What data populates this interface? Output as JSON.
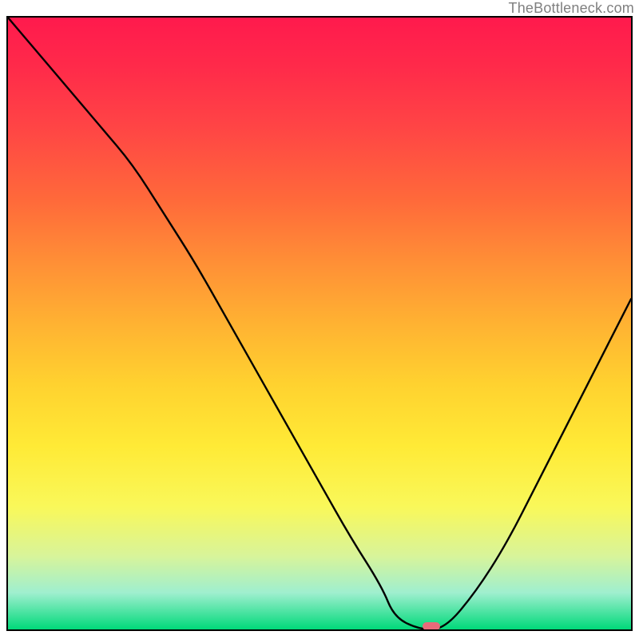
{
  "watermark": "TheBottleneck.com",
  "chart_data": {
    "type": "line",
    "title": "",
    "xlabel": "",
    "ylabel": "",
    "xlim": [
      0,
      100
    ],
    "ylim": [
      0,
      100
    ],
    "x": [
      0,
      5,
      10,
      15,
      20,
      25,
      30,
      35,
      40,
      45,
      50,
      55,
      60,
      62,
      66,
      70,
      75,
      80,
      85,
      90,
      95,
      100
    ],
    "values": [
      100,
      94,
      88,
      82,
      76,
      68,
      60,
      51,
      42,
      33,
      24,
      15,
      7,
      2,
      0,
      0,
      6,
      14,
      24,
      34,
      44,
      54
    ],
    "marker": {
      "x": 68,
      "y": 0
    },
    "background_gradient": {
      "top": "#ff1a4d",
      "mid": "#ffd22f",
      "bottom": "#00d97a"
    }
  }
}
